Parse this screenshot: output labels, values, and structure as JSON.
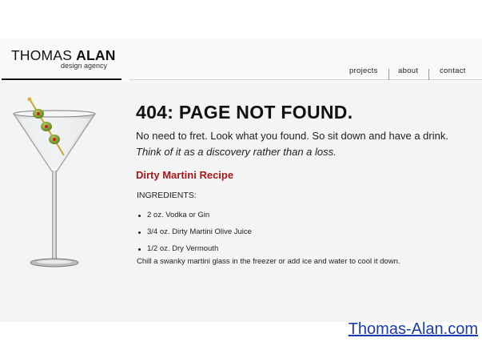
{
  "brand": {
    "name_first": "THOMAS",
    "name_last": "ALAN",
    "tagline": "design agency"
  },
  "nav": {
    "items": [
      {
        "label": "projects"
      },
      {
        "label": "about"
      },
      {
        "label": "contact"
      }
    ]
  },
  "main": {
    "title": "404: PAGE NOT FOUND.",
    "lead": "No need to fret. Look what you found. So sit down and have a drink.",
    "lead_italic": "Think of it as a discovery rather than a loss.",
    "recipe_title": "Dirty Martini Recipe",
    "ingredients_heading": "INGREDIENTS:",
    "ingredients": [
      "2 oz. Vodka or Gin",
      "3/4 oz. Dirty Martini Olive Juice",
      "1/2 oz. Dry Vermouth"
    ],
    "instructions": "Chill a swanky martini glass in the freezer or add ice and water to cool it down."
  },
  "watermark": "Thomas-Alan.com",
  "colors": {
    "accent_red": "#a5171a",
    "link_blue": "#1a3ab0",
    "olive_green": "#7a9a2a",
    "pimento": "#c0261c"
  }
}
